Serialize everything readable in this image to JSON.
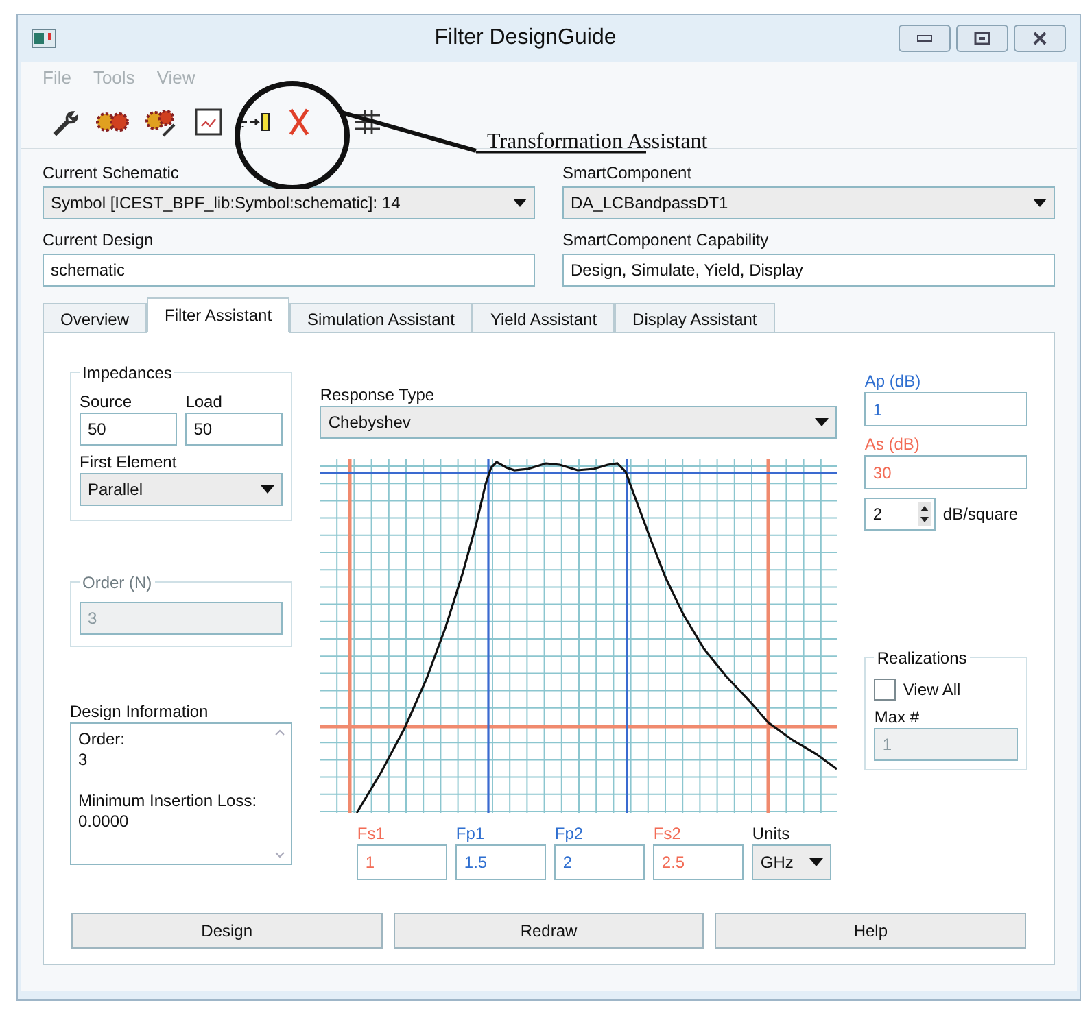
{
  "window": {
    "title": "Filter DesignGuide"
  },
  "menu": [
    {
      "label": "File",
      "disabled": true
    },
    {
      "label": "Tools",
      "disabled": true
    },
    {
      "label": "View",
      "disabled": true
    }
  ],
  "annotation": {
    "label": "Transformation Assistant"
  },
  "current_schematic": {
    "label": "Current Schematic",
    "value": "Symbol [ICEST_BPF_lib:Symbol:schematic]: 14"
  },
  "smart_component": {
    "label": "SmartComponent",
    "value": "DA_LCBandpassDT1"
  },
  "current_design": {
    "label": "Current Design",
    "value": "schematic"
  },
  "capability": {
    "label": "SmartComponent Capability",
    "value": "Design, Simulate, Yield, Display"
  },
  "tabs": [
    {
      "label": "Overview",
      "selected": false
    },
    {
      "label": "Filter Assistant",
      "selected": true
    },
    {
      "label": "Simulation Assistant",
      "selected": false
    },
    {
      "label": "Yield Assistant",
      "selected": false
    },
    {
      "label": "Display Assistant",
      "selected": false
    }
  ],
  "impedances": {
    "title": "Impedances",
    "source_label": "Source",
    "source": "50",
    "load_label": "Load",
    "load": "50",
    "first_element_label": "First Element",
    "first_element": "Parallel"
  },
  "order": {
    "title": "Order (N)",
    "value": "3",
    "disabled": true
  },
  "design_information": {
    "title": "Design Information",
    "entries": [
      {
        "label": "Order:",
        "value": "3"
      },
      {
        "label": "Minimum Insertion Loss:",
        "value": "0.0000"
      }
    ]
  },
  "response_type": {
    "label": "Response Type",
    "value": "Chebyshev"
  },
  "attenuation": [
    {
      "label": "Ap (dB)",
      "value": "1",
      "color": "#2f6fd0"
    },
    {
      "label": "As (dB)",
      "value": "30",
      "color": "#f26b55"
    }
  ],
  "scale": {
    "value": "2",
    "unit": "dB/square"
  },
  "realizations": {
    "title": "Realizations",
    "view_all": {
      "label": "View All",
      "checked": false
    },
    "max_label": "Max #",
    "max": "1",
    "max_disabled": true
  },
  "frequencies": [
    {
      "label": "Fs1",
      "value": "1",
      "color": "#f26b55"
    },
    {
      "label": "Fp1",
      "value": "1.5",
      "color": "#2f6fd0"
    },
    {
      "label": "Fp2",
      "value": "2",
      "color": "#2f6fd0"
    },
    {
      "label": "Fs2",
      "value": "2.5",
      "color": "#f26b55"
    }
  ],
  "units": {
    "label": "Units",
    "value": "GHz"
  },
  "buttons": [
    "Design",
    "Redraw",
    "Help"
  ]
}
